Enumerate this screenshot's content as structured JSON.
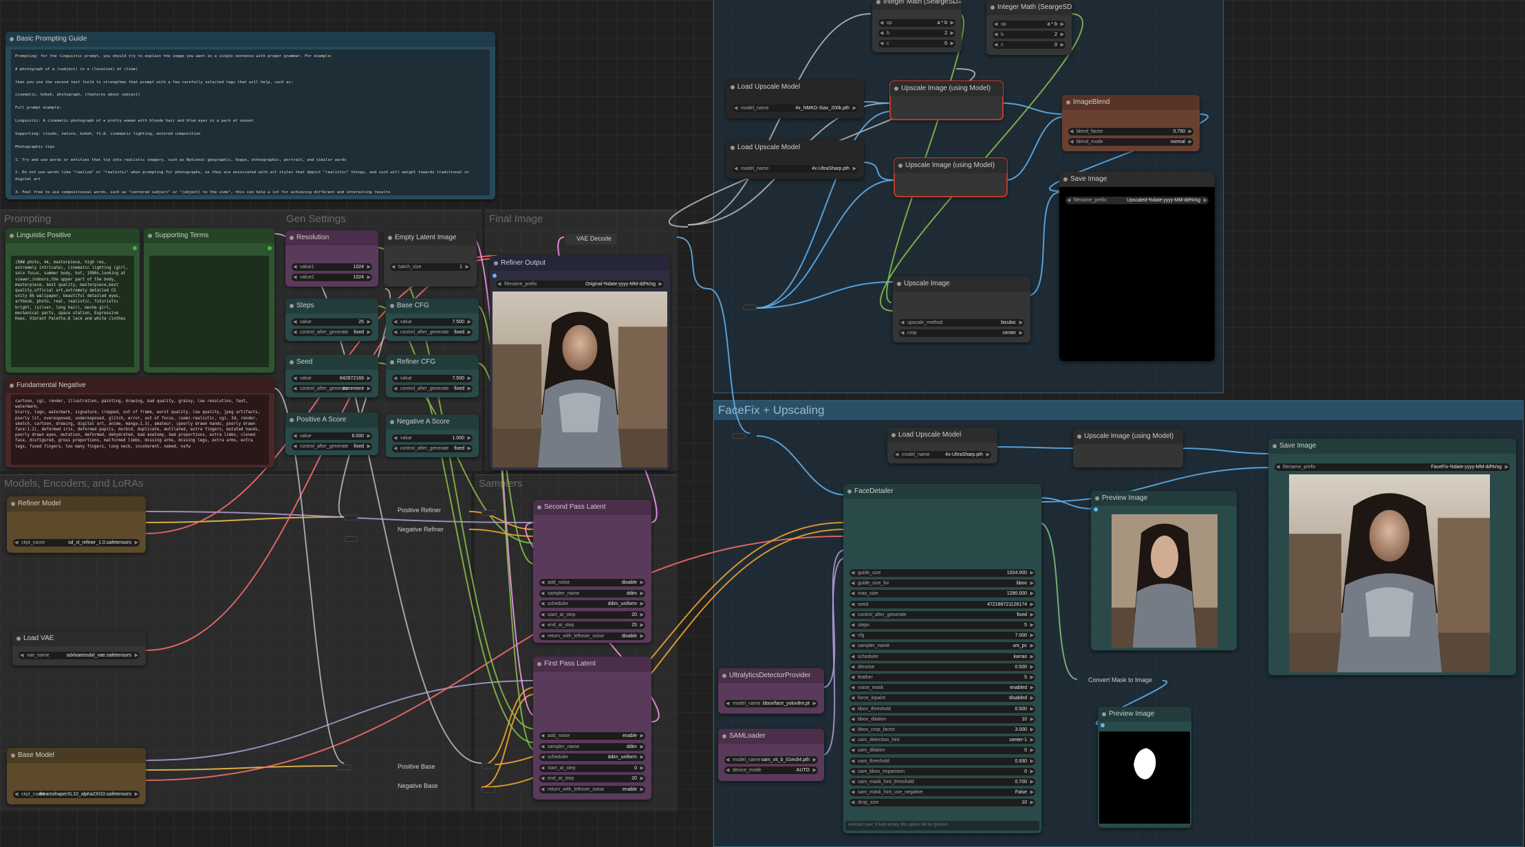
{
  "colors": {
    "clip": "#f7c948",
    "model": "#b39ddb",
    "vae": "#ff6e6e",
    "latent": "#ff9cf9",
    "image": "#64b5f6",
    "cond": "#ffa931",
    "int": "#8bc34a",
    "upscale": "#bbbbbb",
    "mask": "#81c784"
  },
  "groups": {
    "prompting": "Prompting",
    "gen_settings": "Gen Settings",
    "final_image": "Final Image",
    "models": "Models, Encoders, and LoRAs",
    "samplers": "Samplers",
    "facefix": "FaceFix + Upscaling"
  },
  "guide": {
    "title": "Basic Prompting Guide",
    "text": "Prompting: for the linguistic prompt, you should try to explain the image you want in a single sentence with proper grammar. For example:\n\nA photograph of a (subject) in a (location) at (time)\n\nthen you use the second text field to strengthen that prompt with a few carefully selected tags that will help, such as:\n\ncinematic, bokeh, photograph, (features about subject)\n\nFull prompt example:\n\nLinguistic: A cinematic photograph of a pretty woman with blonde hair and blue eyes in a park at sunset\n\nSupporting: clouds, nature, bokeh, f1.8, cinematic lighting, entered composition\n\nPhotographic tips\n\n1. Try and use words or entities that tie into realistic imagery, such as National geographic, Vogue, ethnographic, portrait, and similar words\n\n2. Do not use words like \"realism\" or \"realistic\" when prompting for photographs, as they are associated with art styles that depict \"realistic\" things, and such will weight towards traditional or digital art\n\n3. Feel free to use compositional words, such as \"centered subject\" or \"(object) to the side\", this can help a lot for achieving different and interesting results\n\n4. I recommend not going over 6 on the positive aesthetic score for the refiner when going for realism, I find that the higher you go, the more your images are likely to go into the direction of aesthetic paintings and"
  },
  "linguistic": {
    "title": "Linguistic Positive",
    "text": "(RAW photo, 4k, masterpiece, high res, extremely intricate), cinematic lighting (girl, solo focus, summer body, hot, 1990s,looking at viewer,indoors,the upper part of the body, masterpiece, best quality, masterpiece,best quality,official art,extremely detailed CG unity 8k wallpaper, beautiful detailed eyes, artbook, photo, real, realistic, futuristic bright, (silver, long hair), mecha girl, mechanical parts, space station, Expressive Hues, Vibrant Palette,8 lack and white clothes"
  },
  "supporting": {
    "title": "Supporting Terms"
  },
  "negative": {
    "title": "Fundamental Negative",
    "text": "cartoon, cgi, render, illustration, painting, drawing, bad quality, grainy, low resolution, text, watermark,\nblurry, logo, watermark, signature, cropped, out of frame, worst quality, low quality, jpeg artifacts, poorly lit, overexposed, underexposed, glitch, error, out of focus, (semi-realistic, cgi, 3d, render, sketch, cartoon, drawing, digital art, anime, manga:1.3), amateur, (poorly drawn hands, poorly drawn face:1.2), deformed iris, deformed pupils, morbid, duplicate, mutilated, extra fingers, mutated hands, poorly drawn eyes, mutation, deformed, dehydrated, bad anatomy, bad proportions, extra limbs, cloned face, disfigured, gross proportions, malformed limbs, missing arms, missing legs, extra arms, extra legs, fused fingers, too many fingers, long neck, incoherent, naked, nsfw"
  },
  "resolution": {
    "title": "Resolution",
    "w1": "value1",
    "v1": "1024",
    "w2": "value2",
    "v2": "1024"
  },
  "empty_latent": {
    "title": "Empty Latent Image",
    "w1": "batch_size",
    "v1": "1"
  },
  "steps": {
    "title": "Steps",
    "w1": "value",
    "v1": "25",
    "w2": "control_after_generate",
    "v2": "fixed"
  },
  "base_cfg": {
    "title": "Base CFG",
    "w1": "value",
    "v1": "7.500",
    "w2": "control_after_generate",
    "v2": "fixed"
  },
  "seed": {
    "title": "Seed",
    "w1": "value",
    "v1": "842872166",
    "w2": "control_after_generate",
    "v2": "increment"
  },
  "refiner_cfg": {
    "title": "Refiner CFG",
    "w1": "value",
    "v1": "7.500",
    "w2": "control_after_generate",
    "v2": "fixed"
  },
  "pos_a": {
    "title": "Positive A Score",
    "w1": "value",
    "v1": "6.000",
    "w2": "control_after_generate",
    "v2": "fixed"
  },
  "neg_a": {
    "title": "Negative A Score",
    "w1": "value",
    "v1": "1.000",
    "w2": "control_after_generate",
    "v2": "fixed"
  },
  "vae_decode": {
    "title": "VAE Decode"
  },
  "refiner_output": {
    "title": "Refiner Output",
    "w1": "filename_prefix",
    "v1": "Original-%date:yyyy-MM-dd%/sg"
  },
  "refiner_model": {
    "title": "Refiner Model",
    "w1": "ckpt_name",
    "v1": "sd_xl_refiner_1.0.safetensors"
  },
  "load_vae": {
    "title": "Load VAE",
    "w1": "vae_name",
    "v1": "sdxlvaeissdxl_vae.safetensors"
  },
  "base_model": {
    "title": "Base Model",
    "w1": "ckpt_name",
    "v1": "dreamshaperXL10_alpha2Xl10.safetensors"
  },
  "pos_refiner": "Positive Refiner",
  "neg_refiner": "Negative Refiner",
  "pos_base": "Positive Base",
  "neg_base": "Negative Base",
  "second_pass": {
    "title": "Second Pass Latent",
    "rows": [
      [
        "add_noise",
        "disable"
      ],
      [
        "sampler_name",
        "ddim"
      ],
      [
        "scheduler",
        "ddim_uniform"
      ],
      [
        "start_at_step",
        "20"
      ],
      [
        "end_at_step",
        "25"
      ],
      [
        "return_with_leftover_noise",
        "disable"
      ]
    ]
  },
  "first_pass": {
    "title": "First Pass Latent",
    "rows": [
      [
        "add_noise",
        "enable"
      ],
      [
        "sampler_name",
        "ddim"
      ],
      [
        "scheduler",
        "ddim_uniform"
      ],
      [
        "start_at_step",
        "0"
      ],
      [
        "end_at_step",
        "20"
      ],
      [
        "return_with_leftover_noise",
        "enable"
      ]
    ]
  },
  "int_math1": {
    "title": "Integer Math (SeargeSDXL)",
    "rows": [
      [
        "op",
        "a * b"
      ],
      [
        "b",
        "2"
      ],
      [
        "c",
        "0"
      ]
    ]
  },
  "int_math2": {
    "title": "Integer Math (SeargeSDXL)",
    "rows": [
      [
        "op",
        "a * b"
      ],
      [
        "b",
        "2"
      ],
      [
        "c",
        "0"
      ]
    ]
  },
  "load_up1": {
    "title": "Load Upscale Model",
    "w1": "model_name",
    "v1": "4x_NMKD-Siax_200k.pth"
  },
  "load_up2": {
    "title": "Load Upscale Model",
    "w1": "model_name",
    "v1": "4x-UltraSharp.pth"
  },
  "up_img1": {
    "title": "Upscale Image (using Model)"
  },
  "up_img2": {
    "title": "Upscale Image (using Model)"
  },
  "imageblend": {
    "title": "ImageBlend",
    "w1": "blend_factor",
    "v1": "0.750",
    "w2": "blend_mode",
    "v2": "normal"
  },
  "save_top": {
    "title": "Save Image",
    "w1": "filename_prefix",
    "v1": "Upscaled-%date:yyyy-MM-dd%/sg"
  },
  "upscale_image": {
    "title": "Upscale Image",
    "w1": "upscale_method",
    "v1": "bicubic",
    "w2": "crop",
    "v2": "center"
  },
  "load_up3": {
    "title": "Load Upscale Model",
    "w1": "model_name",
    "v1": "4x-UltraSharp.pth"
  },
  "up_img3": {
    "title": "Upscale Image (using Model)"
  },
  "save_bottom": {
    "title": "Save Image",
    "w1": "filename_prefix",
    "v1": "FaceFix-%date:yyyy-MM-dd%/sg"
  },
  "facedetailer": {
    "title": "FaceDetailer",
    "rows": [
      [
        "guide_size",
        "1024.000"
      ],
      [
        "guide_size_for",
        "bbox"
      ],
      [
        "max_size",
        "1280.000"
      ],
      [
        "seed",
        "472186721126174"
      ],
      [
        "control_after_generate",
        "fixed"
      ],
      [
        "steps",
        "5"
      ],
      [
        "cfg",
        "7.000"
      ],
      [
        "sampler_name",
        "uni_pc"
      ],
      [
        "scheduler",
        "karras"
      ],
      [
        "denoise",
        "0.500"
      ],
      [
        "feather",
        "5"
      ],
      [
        "noise_mask",
        "enabled"
      ],
      [
        "force_inpaint",
        "disabled"
      ],
      [
        "bbox_threshold",
        "0.500"
      ],
      [
        "bbox_dilation",
        "10"
      ],
      [
        "bbox_crop_factor",
        "3.000"
      ],
      [
        "sam_detection_hint",
        "center-1"
      ],
      [
        "sam_dilation",
        "0"
      ],
      [
        "sam_threshold",
        "0.930"
      ],
      [
        "sam_bbox_expansion",
        "0"
      ],
      [
        "sam_mask_hint_threshold",
        "0.700"
      ],
      [
        "sam_mask_hint_use_negative",
        "False"
      ],
      [
        "drop_size",
        "10"
      ]
    ],
    "note": "wildcard spec: if kept empty, this option will be ignored"
  },
  "ultralytics": {
    "title": "UltralyticsDetectorProvider",
    "w1": "model_name",
    "v1": "bbox/face_yolov8m.pt"
  },
  "samloader": {
    "title": "SAMLoader",
    "w1": "model_name",
    "v1": "sam_vit_b_01ec64.pth",
    "w2": "device_mode",
    "v2": "AUTO"
  },
  "preview1": {
    "title": "Preview Image"
  },
  "convert_mask": "Convert Mask to Image",
  "preview2": {
    "title": "Preview Image"
  }
}
